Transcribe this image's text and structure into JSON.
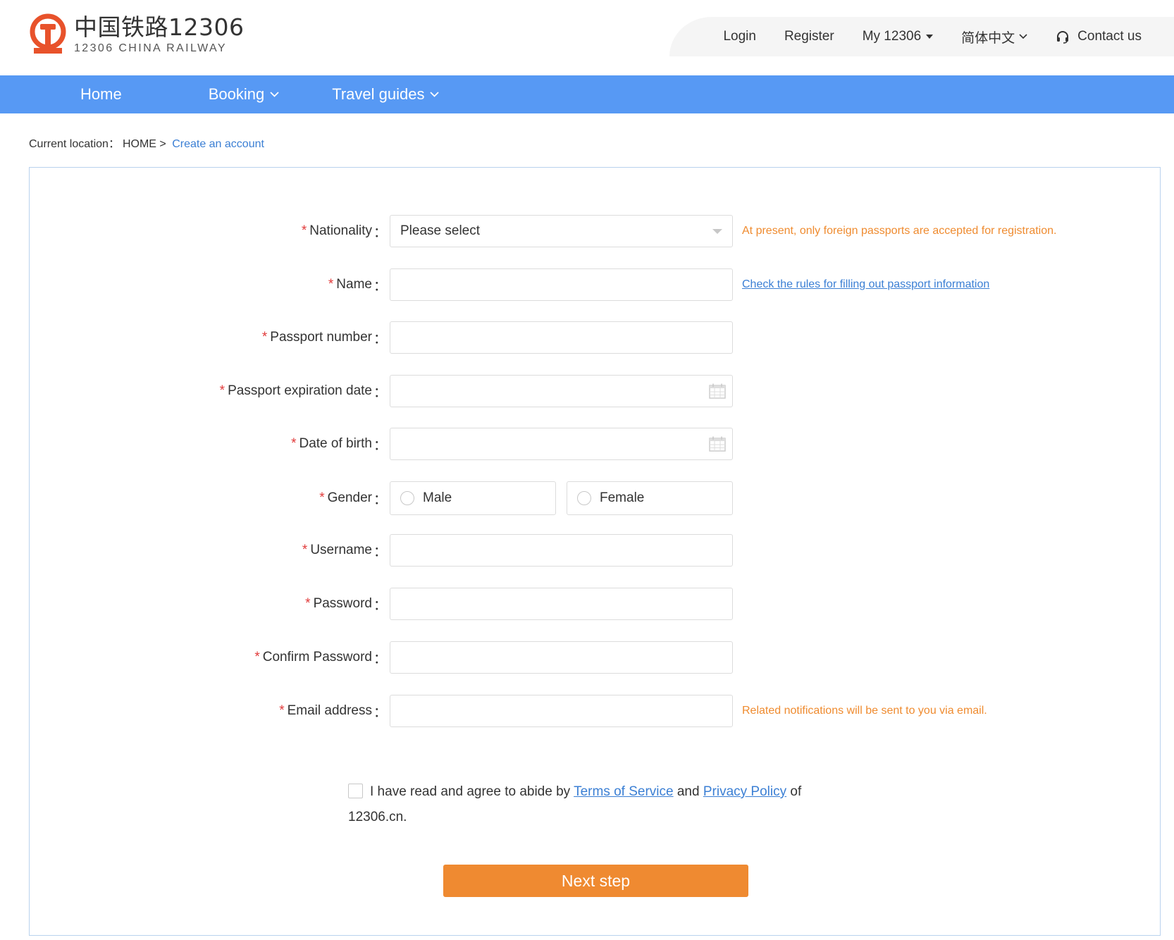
{
  "brand": {
    "name_cn": "中国铁路12306",
    "name_en": "12306 CHINA RAILWAY",
    "logo_color": "#e8522b"
  },
  "top_links": {
    "login": "Login",
    "register": "Register",
    "my12306": "My 12306",
    "language": "简体中文",
    "contact": "Contact us"
  },
  "nav": {
    "home": "Home",
    "booking": "Booking",
    "guides": "Travel guides",
    "bg_color": "#5799f4"
  },
  "breadcrumb": {
    "prefix": "Current location：",
    "home": "HOME",
    "separator": " > ",
    "current": "Create an account"
  },
  "form": {
    "required_mark": "*",
    "colon": "：",
    "nationality": {
      "label": "Nationality",
      "value": "Please select",
      "hint": "At present, only foreign passports are accepted for registration."
    },
    "name": {
      "label": "Name",
      "value": "",
      "hint": "Check the rules for filling out passport information"
    },
    "passport_number": {
      "label": "Passport number",
      "value": ""
    },
    "passport_expiration": {
      "label": "Passport expiration date",
      "value": ""
    },
    "date_of_birth": {
      "label": "Date of birth",
      "value": ""
    },
    "gender": {
      "label": "Gender",
      "options": [
        "Male",
        "Female"
      ]
    },
    "username": {
      "label": "Username",
      "value": ""
    },
    "password": {
      "label": "Password",
      "value": ""
    },
    "confirm_password": {
      "label": "Confirm Password",
      "value": ""
    },
    "email": {
      "label": "Email address",
      "value": "",
      "hint": "Related notifications will be sent to you via email."
    }
  },
  "agreement": {
    "text_before": "I have read and agree to abide by ",
    "terms": "Terms of Service",
    "and": " and ",
    "privacy": "Privacy Policy",
    "text_after": " of 12306.cn."
  },
  "next_button": "Next step",
  "colors": {
    "accent_orange": "#ef8a31",
    "link_blue": "#3b7fd4",
    "required_red": "#e13a3a"
  }
}
